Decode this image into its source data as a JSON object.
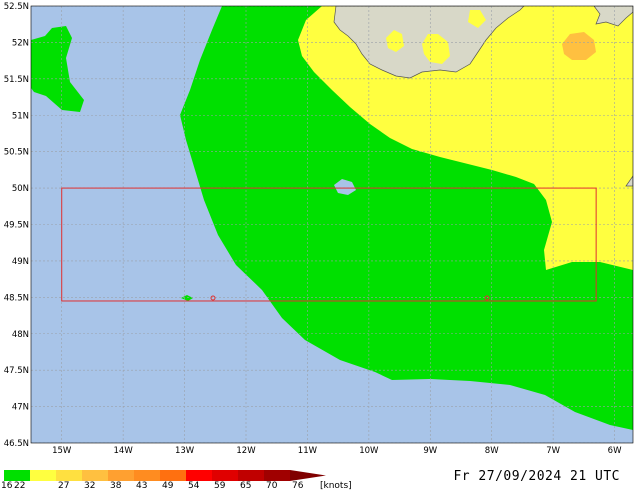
{
  "map": {
    "lon_range": [
      -15.5,
      -5.7
    ],
    "lat_range": [
      46.5,
      52.5
    ],
    "lon_ticks": [
      "15W",
      "14W",
      "13W",
      "12W",
      "11W",
      "10W",
      "9W",
      "8W",
      "7W",
      "6W"
    ],
    "lat_ticks": [
      "52.5N",
      "52N",
      "51.5N",
      "51N",
      "50.5N",
      "50N",
      "49.5N",
      "49N",
      "48.5N",
      "48N",
      "47.5N",
      "47N",
      "46.5N"
    ],
    "domain_box": {
      "lon": [
        -15.0,
        -6.3
      ],
      "lat": [
        48.45,
        50.0
      ]
    },
    "colors": {
      "sea": "#a8c4e8",
      "land": "#d8d8c8",
      "grid": "#9aa0a8",
      "box": "#e03030"
    }
  },
  "legend": {
    "labels": [
      "16",
      "22",
      "27",
      "32",
      "38",
      "43",
      "49",
      "54",
      "59",
      "65",
      "70",
      "76"
    ],
    "unit": "[knots]",
    "colors": [
      "#00e000",
      "#ffff40",
      "#ffe040",
      "#ffc040",
      "#ffa030",
      "#ff8c20",
      "#ff7010",
      "#ff0000",
      "#e00000",
      "#c00000",
      "#a00000",
      "#800000"
    ]
  },
  "timestamp": "Fr 27/09/2024 21 UTC"
}
